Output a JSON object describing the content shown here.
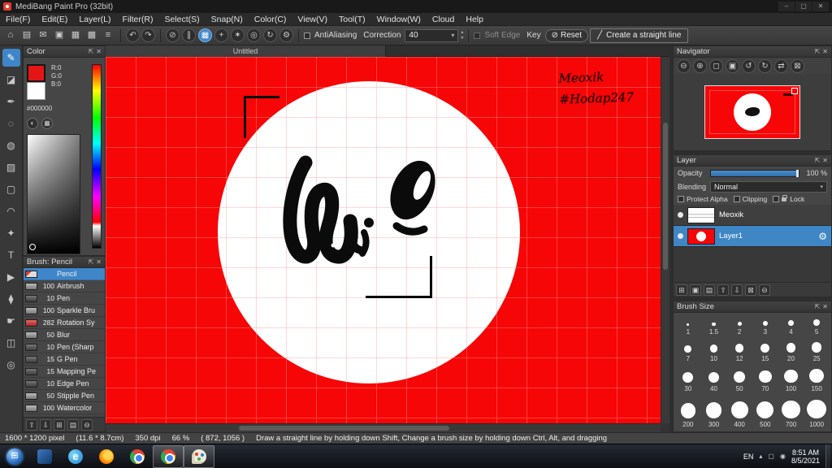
{
  "window": {
    "title": "MediBang Paint Pro (32bit)"
  },
  "icons": {
    "minimize": "–",
    "maximize": "▢",
    "close": "✕",
    "popout": "⇱",
    "panel_close": "✕",
    "dropdown": "▾",
    "step_up": "▴",
    "step_down": "▾",
    "undo": "↶",
    "redo": "↷",
    "reset_glyph": "⊘",
    "line_glyph": "╱",
    "gear": "⚙",
    "rgb_toggle": "◐",
    "grid_toggle": "▦"
  },
  "menu": {
    "items": [
      "File(F)",
      "Edit(E)",
      "Layer(L)",
      "Filter(R)",
      "Select(S)",
      "Snap(N)",
      "Color(C)",
      "View(V)",
      "Tool(T)",
      "Window(W)",
      "Cloud",
      "Help"
    ]
  },
  "toolbar": {
    "file_icons": [
      {
        "name": "home-icon",
        "glyph": "⌂"
      },
      {
        "name": "save-icon",
        "glyph": "▤"
      },
      {
        "name": "publish-icon",
        "glyph": "✉"
      },
      {
        "name": "panel-toggle-icon",
        "glyph": "▣"
      },
      {
        "name": "grid-toggle-icon",
        "glyph": "▦"
      },
      {
        "name": "material-panel-icon",
        "glyph": "▩"
      },
      {
        "name": "menu-list-icon",
        "glyph": "≡"
      }
    ],
    "snap_icons": [
      {
        "name": "snap-off-icon",
        "glyph": "⊘",
        "cls": ""
      },
      {
        "name": "snap-parallel-icon",
        "glyph": "∥",
        "cls": ""
      },
      {
        "name": "snap-grid-icon",
        "glyph": "▦",
        "cls": "selected"
      },
      {
        "name": "snap-cross-icon",
        "glyph": "+",
        "cls": ""
      },
      {
        "name": "snap-radial-icon",
        "glyph": "✶",
        "cls": ""
      },
      {
        "name": "snap-ellipse-icon",
        "glyph": "◎",
        "cls": ""
      },
      {
        "name": "snap-curve-icon",
        "glyph": "↻",
        "cls": ""
      },
      {
        "name": "snap-settings-icon",
        "glyph": "⚙",
        "cls": ""
      }
    ],
    "antialiasing_label": "AntiAliasing",
    "correction_label": "Correction",
    "correction_value": "40",
    "soft_edge_label": "Soft Edge",
    "key_label": "Key",
    "reset_label": "Reset",
    "straight_line_label": "Create a straight line"
  },
  "tools": {
    "items": [
      {
        "name": "brush-tool",
        "glyph": "✎",
        "cls": "selected"
      },
      {
        "name": "eraser-tool",
        "glyph": "◪",
        "cls": ""
      },
      {
        "name": "pen-tool",
        "glyph": "✒",
        "cls": ""
      },
      {
        "name": "airbrush-tool",
        "glyph": "◌",
        "cls": ""
      },
      {
        "name": "fill-tool",
        "glyph": "◍",
        "cls": ""
      },
      {
        "name": "gradient-tool",
        "glyph": "▨",
        "cls": ""
      },
      {
        "name": "select-tool",
        "glyph": "▢",
        "cls": ""
      },
      {
        "name": "lasso-tool",
        "glyph": "◠",
        "cls": ""
      },
      {
        "name": "magic-wand-tool",
        "glyph": "✦",
        "cls": ""
      },
      {
        "name": "text-tool",
        "glyph": "T",
        "cls": ""
      },
      {
        "name": "operation-tool",
        "glyph": "▶",
        "cls": ""
      },
      {
        "name": "eyedropper-tool",
        "glyph": "⧫",
        "cls": ""
      },
      {
        "name": "hand-tool",
        "glyph": "☛",
        "cls": ""
      },
      {
        "name": "divide-tool",
        "glyph": "◫",
        "cls": ""
      },
      {
        "name": "zoom-tool",
        "glyph": "◎",
        "cls": ""
      }
    ]
  },
  "color_panel": {
    "title": "Color",
    "r": "R:0",
    "g": "G:0",
    "b": "B:0",
    "hex": "#000000"
  },
  "brush_panel": {
    "title": "Brush: Pencil",
    "brushes": [
      {
        "size": "",
        "name": "Pencil",
        "cls": "selected",
        "thumb": "pencil"
      },
      {
        "size": "100",
        "name": "Airbrush",
        "cls": "",
        "thumb": "gray"
      },
      {
        "size": "10",
        "name": "Pen",
        "cls": "",
        "thumb": "dark"
      },
      {
        "size": "100",
        "name": "Sparkle Bru",
        "cls": "",
        "thumb": "gray"
      },
      {
        "size": "282",
        "name": "Rotation Sy",
        "cls": "",
        "thumb": "red"
      },
      {
        "size": "50",
        "name": "Blur",
        "cls": "",
        "thumb": "gray"
      },
      {
        "size": "10",
        "name": "Pen (Sharp",
        "cls": "",
        "thumb": "dark"
      },
      {
        "size": "15",
        "name": "G Pen",
        "cls": "",
        "thumb": "dark"
      },
      {
        "size": "15",
        "name": "Mapping Pe",
        "cls": "",
        "thumb": "dark"
      },
      {
        "size": "10",
        "name": "Edge Pen",
        "cls": "",
        "thumb": "dark"
      },
      {
        "size": "50",
        "name": "Stipple Pen",
        "cls": "",
        "thumb": "gray"
      },
      {
        "size": "100",
        "name": "Watercolor",
        "cls": "",
        "thumb": "gray"
      }
    ]
  },
  "brush_bottom_icons": [
    {
      "name": "brush-up-icon",
      "glyph": "⇧"
    },
    {
      "name": "brush-down-icon",
      "glyph": "⇩"
    },
    {
      "name": "add-brush-icon",
      "glyph": "⊞"
    },
    {
      "name": "brush-folder-icon",
      "glyph": "▤"
    },
    {
      "name": "delete-brush-icon",
      "glyph": "⊖"
    }
  ],
  "canvas": {
    "tab": "Untitled",
    "watermark_line1": "Meoxik",
    "watermark_line2": "#Hodap247"
  },
  "navigator": {
    "title": "Navigator",
    "buttons": [
      {
        "name": "zoom-out-icon",
        "glyph": "⊖"
      },
      {
        "name": "zoom-in-icon",
        "glyph": "⊕"
      },
      {
        "name": "zoom-100-icon",
        "glyph": "◻"
      },
      {
        "name": "fit-window-icon",
        "glyph": "▣"
      },
      {
        "name": "rotate-left-icon",
        "glyph": "↺"
      },
      {
        "name": "rotate-right-icon",
        "glyph": "↻"
      },
      {
        "name": "flip-view-icon",
        "glyph": "⇄"
      },
      {
        "name": "reset-view-icon",
        "glyph": "⊠"
      }
    ]
  },
  "layer_panel": {
    "title": "Layer",
    "opacity_label": "Opacity",
    "opacity_value": "100 %",
    "blending_label": "Blending",
    "blending_value": "Normal",
    "protect_alpha_label": "Protect Alpha",
    "clipping_label": "Clipping",
    "lock_label": "Lock",
    "layers": [
      {
        "name": "Meoxik",
        "cls": "",
        "thumb": "white"
      },
      {
        "name": "Layer1",
        "cls": "selected",
        "thumb": "red"
      }
    ],
    "bottom_icons": [
      {
        "name": "add-layer-icon",
        "glyph": "⊞"
      },
      {
        "name": "duplicate-layer-icon",
        "glyph": "▣"
      },
      {
        "name": "layer-folder-icon",
        "glyph": "▤"
      },
      {
        "name": "move-layer-up-icon",
        "glyph": "⇧"
      },
      {
        "name": "move-layer-down-icon",
        "glyph": "⇩"
      },
      {
        "name": "merge-down-icon",
        "glyph": "⊠"
      },
      {
        "name": "delete-layer-icon",
        "glyph": "⊖"
      }
    ]
  },
  "brush_size_panel": {
    "title": "Brush Size",
    "sizes": [
      "1",
      "1.5",
      "2",
      "3",
      "4",
      "5",
      "7",
      "10",
      "12",
      "15",
      "20",
      "25",
      "30",
      "40",
      "50",
      "70",
      "100",
      "150",
      "200",
      "300",
      "400",
      "500",
      "700",
      "1000"
    ]
  },
  "status": {
    "dimensions": "1600 * 1200 pixel",
    "size_cm": "(11.6 * 8.7cm)",
    "dpi": "350 dpi",
    "zoom": "66 %",
    "coords": "( 872, 1056 )",
    "hint": "Draw a straight line by holding down Shift, Change a brush size by holding down Ctrl, Alt, and dragging"
  },
  "taskbar": {
    "language": "EN",
    "time": "8:51 AM",
    "date": "8/5/2021",
    "icons": [
      {
        "name": "taskbar-app-icon",
        "type": "bluebox",
        "cls": ""
      },
      {
        "name": "taskbar-edge-icon",
        "type": "edge",
        "cls": ""
      },
      {
        "name": "taskbar-firefox-icon",
        "type": "firefox",
        "cls": ""
      },
      {
        "name": "taskbar-chrome-icon",
        "type": "chrome",
        "cls": ""
      },
      {
        "name": "taskbar-chrome-active-icon",
        "type": "chrome",
        "cls": "active"
      },
      {
        "name": "taskbar-medibang-icon",
        "type": "palette",
        "cls": "active"
      }
    ]
  }
}
